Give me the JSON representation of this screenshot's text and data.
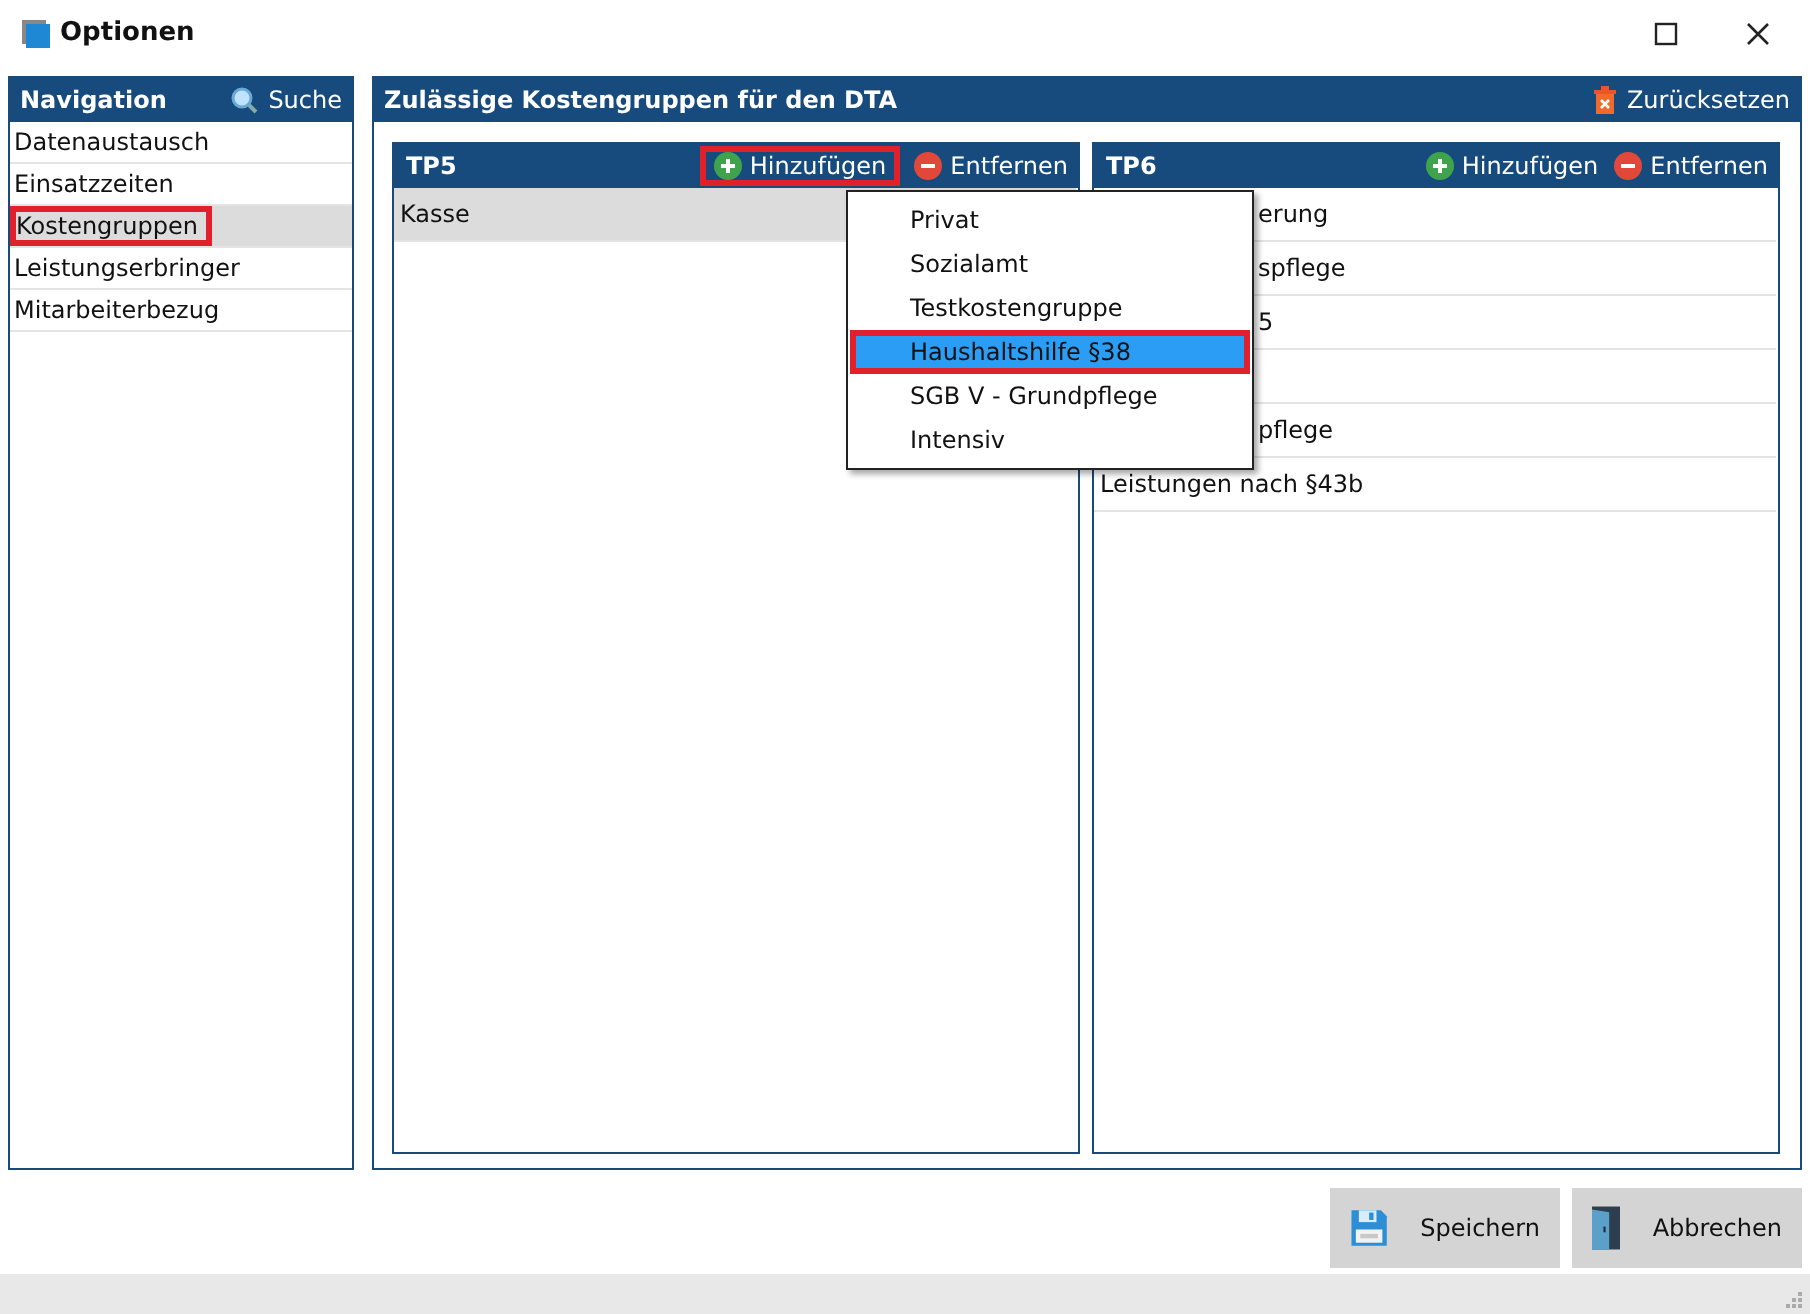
{
  "window": {
    "title": "Optionen"
  },
  "navigation": {
    "title": "Navigation",
    "search_label": "Suche",
    "items": [
      {
        "label": "Datenaustausch",
        "selected": false,
        "highlighted": false
      },
      {
        "label": "Einsatzzeiten",
        "selected": false,
        "highlighted": false
      },
      {
        "label": "Kostengruppen",
        "selected": true,
        "highlighted": true
      },
      {
        "label": "Leistungserbringer",
        "selected": false,
        "highlighted": false
      },
      {
        "label": "Mitarbeiterbezug",
        "selected": false,
        "highlighted": false
      }
    ]
  },
  "main": {
    "title": "Zulässige Kostengruppen für den DTA",
    "reset_label": "Zurücksetzen",
    "lists": [
      {
        "title": "TP5",
        "add_label": "Hinzufügen",
        "remove_label": "Entfernen",
        "add_highlighted": true,
        "rows": [
          {
            "text": "Kasse",
            "selected": true,
            "covered": false
          }
        ]
      },
      {
        "title": "TP6",
        "add_label": "Hinzufügen",
        "remove_label": "Entfernen",
        "add_highlighted": false,
        "rows": [
          {
            "text": "erung",
            "selected": false,
            "covered": true
          },
          {
            "text": "spflege",
            "selected": false,
            "covered": true
          },
          {
            "text": "5",
            "selected": false,
            "covered": true
          },
          {
            "selected": false
          },
          {
            "text": "pflege",
            "selected": false,
            "covered": true
          },
          {
            "text": "Leistungen nach §43b",
            "selected": false,
            "covered": false
          }
        ]
      }
    ]
  },
  "popup_menu": {
    "items": [
      {
        "label": "Privat",
        "selected": false,
        "highlighted": false
      },
      {
        "label": "Sozialamt",
        "selected": false,
        "highlighted": false
      },
      {
        "label": "Testkostengruppe",
        "selected": false,
        "highlighted": false
      },
      {
        "label": "Haushaltshilfe §38",
        "selected": true,
        "highlighted": true
      },
      {
        "label": "SGB V - Grundpflege",
        "selected": false,
        "highlighted": false
      },
      {
        "label": "Intensiv",
        "selected": false,
        "highlighted": false
      }
    ]
  },
  "buttons": [
    {
      "kind": "save",
      "label": "Speichern"
    },
    {
      "kind": "cancel",
      "label": "Abbrechen"
    }
  ]
}
